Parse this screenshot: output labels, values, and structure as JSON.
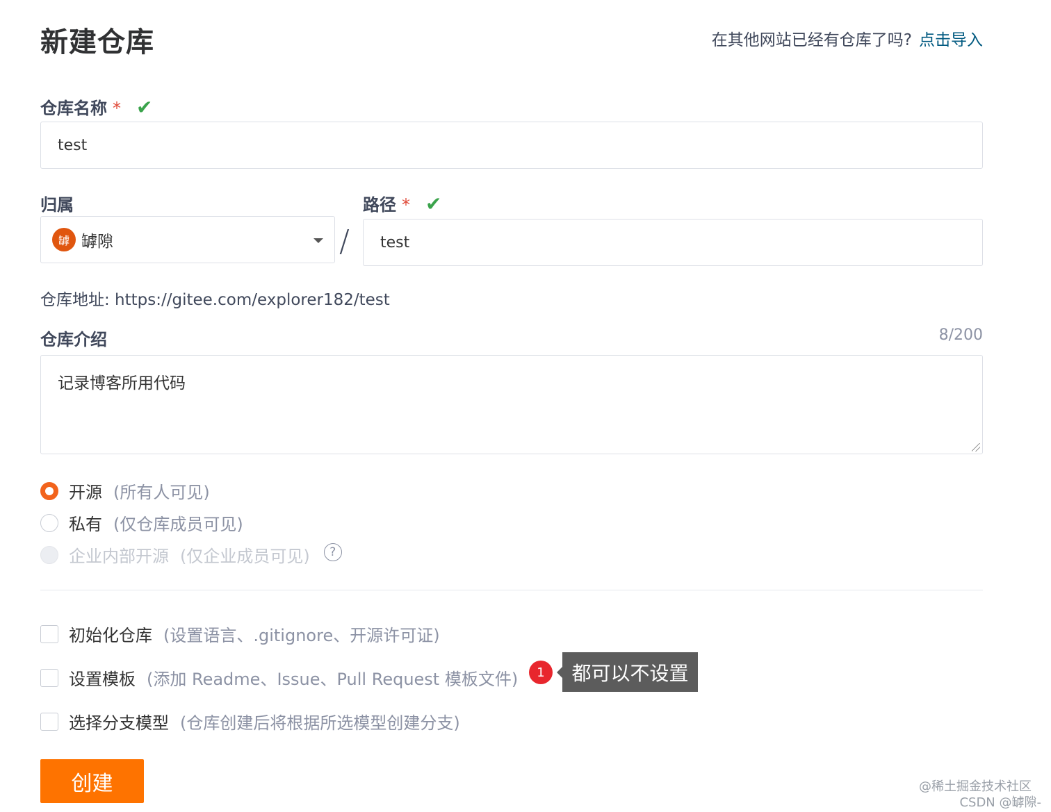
{
  "header": {
    "title": "新建仓库",
    "import_hint": "在其他网站已经有仓库了吗?",
    "import_link": "点击导入"
  },
  "repo_name": {
    "label": "仓库名称",
    "required_mark": "*",
    "check": "✔",
    "value": "test"
  },
  "owner": {
    "label": "归属",
    "avatar_char": "罅",
    "value": "罅隙"
  },
  "separator": "/",
  "path": {
    "label": "路径",
    "required_mark": "*",
    "check": "✔",
    "value": "test"
  },
  "address": {
    "text": "仓库地址: https://gitee.com/explorer182/test"
  },
  "description": {
    "label": "仓库介绍",
    "counter": "8/200",
    "value": "记录博客所用代码"
  },
  "visibility": {
    "selected": "open",
    "options": [
      {
        "label": "开源",
        "note": "(所有人可见)"
      },
      {
        "label": "私有",
        "note": "(仅仓库成员可见)"
      },
      {
        "label": "企业内部开源",
        "note": "(仅企业成员可见)",
        "help": "?"
      }
    ]
  },
  "extras": {
    "init": {
      "label": "初始化仓库",
      "note": "(设置语言、.gitignore、开源许可证)",
      "checked": false
    },
    "template": {
      "label": "设置模板",
      "note": "(添加 Readme、Issue、Pull Request 模板文件)",
      "checked": false
    },
    "branch": {
      "label": "选择分支模型",
      "note": "(仓库创建后将根据所选模型创建分支)",
      "checked": false
    }
  },
  "annotation": {
    "badge": "1",
    "text": "都可以不设置"
  },
  "submit": {
    "label": "创建"
  },
  "watermark": {
    "line1": "@稀土掘金技术社区",
    "line2": "CSDN @罅隙-"
  },
  "colors": {
    "accent": "#fe7300",
    "link": "#005980",
    "success": "#3aa34b",
    "required": "#e04b3a",
    "badge": "#e8262d"
  }
}
